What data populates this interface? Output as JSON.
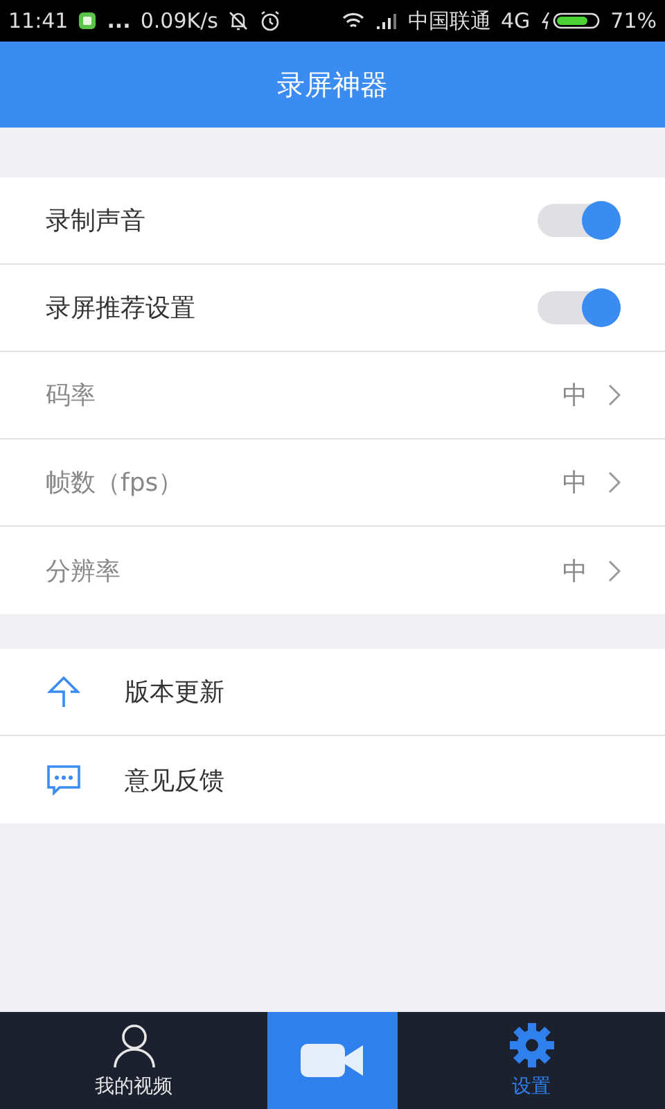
{
  "status_bar": {
    "time": "11:41",
    "dots": "...",
    "speed": "0.09K/s",
    "carrier": "中国联通",
    "network": "4G",
    "battery": "71%"
  },
  "header": {
    "title": "录屏神器"
  },
  "settings": [
    {
      "kind": "toggle",
      "label": "录制声音",
      "on": true
    },
    {
      "kind": "toggle",
      "label": "录屏推荐设置",
      "on": true
    },
    {
      "kind": "option",
      "label": "码率",
      "value": "中",
      "disabled": true
    },
    {
      "kind": "option",
      "label": "帧数（fps）",
      "value": "中",
      "disabled": true
    },
    {
      "kind": "option",
      "label": "分辨率",
      "value": "中",
      "disabled": true
    }
  ],
  "links": [
    {
      "kind": "update",
      "label": "版本更新"
    },
    {
      "kind": "feedback",
      "label": "意见反馈"
    }
  ],
  "nav": [
    {
      "kind": "profile",
      "label": "我的视频",
      "selected": false
    },
    {
      "kind": "record"
    },
    {
      "kind": "settings",
      "label": "设置",
      "selected": true
    }
  ]
}
